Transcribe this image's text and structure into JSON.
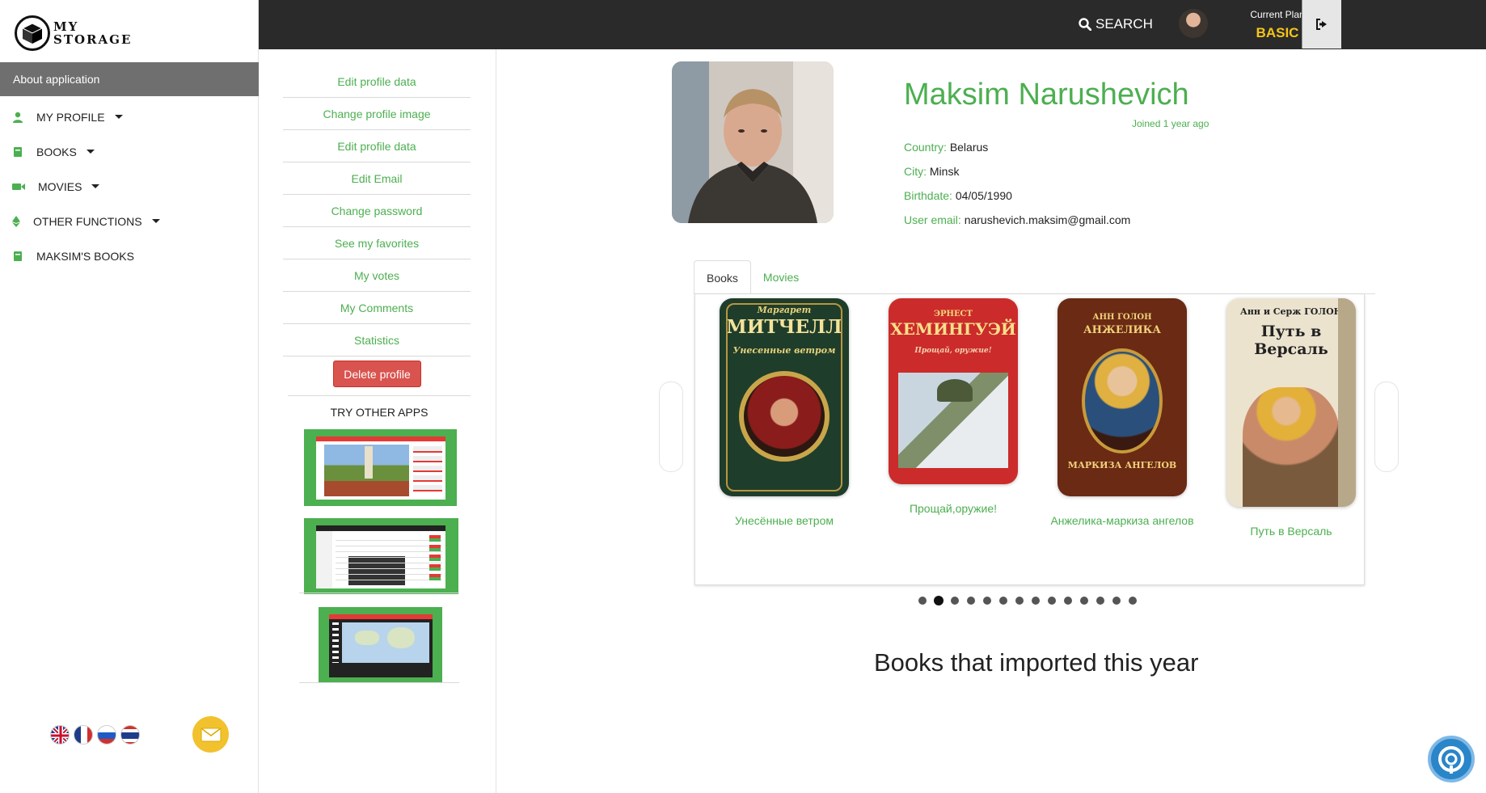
{
  "sidebar": {
    "logo_text_line1": "MY",
    "logo_text_line2": "STORAGE",
    "about": "About application",
    "items": [
      {
        "label": "MY PROFILE",
        "icon": "user-icon"
      },
      {
        "label": "BOOKS",
        "icon": "book-icon"
      },
      {
        "label": "MOVIES",
        "icon": "video-camera-icon"
      },
      {
        "label": "OTHER FUNCTIONS",
        "icon": "ethereum-icon"
      },
      {
        "label": "MAKSIM'S BOOKS",
        "icon": "book-icon"
      }
    ],
    "languages": [
      "English",
      "French",
      "Russian",
      "Thai"
    ]
  },
  "topbar": {
    "search_label": "SEARCH",
    "plan_label": "Current Plan",
    "plan_value": "BASIC"
  },
  "profile_menu": {
    "links": [
      "Edit profile data",
      "Change profile image",
      "Edit profile data",
      "Edit Email",
      "Change password",
      "See my favorites",
      "My votes",
      "My Comments",
      "Statistics"
    ],
    "delete_label": "Delete profile",
    "try_apps_label": "TRY OTHER APPS"
  },
  "profile": {
    "name": "Maksim Narushevich",
    "joined": "Joined 1 year ago",
    "country_label": "Country:",
    "country": "Belarus",
    "city_label": "City:",
    "city": "Minsk",
    "birthdate_label": "Birthdate:",
    "birthdate": "04/05/1990",
    "email_label": "User email:",
    "email": "narushevich.maksim@gmail.com"
  },
  "tabs": [
    {
      "label": "Books",
      "active": true
    },
    {
      "label": "Movies",
      "active": false
    }
  ],
  "books": [
    {
      "title": "Унесённые ветром",
      "author": "Маргарет",
      "cover_title": "МИТЧЕЛЛ",
      "cover_sub": "Унесенные ветром"
    },
    {
      "title": "Прощай,оружие!",
      "author": "ЭРНЕСТ",
      "cover_title": "ХЕМИНГУЭЙ",
      "cover_sub": "Прощай, оружие!"
    },
    {
      "title": "Анжелика-маркиза ангелов",
      "author": "АНН ГОЛОН",
      "cover_title": "АНЖЕЛИКА",
      "cover_sub": "МАРКИЗА АНГЕЛОВ"
    },
    {
      "title": "Путь в Версаль",
      "author": "Анн и Серж ГОЛОН",
      "cover_title": "Путь в Версаль",
      "cover_sub": ""
    }
  ],
  "carousel": {
    "dot_count": 14,
    "active_index": 1
  },
  "section_title": "Books that imported this year",
  "colors": {
    "accent": "#4caf50",
    "topbar": "#2a2a2a",
    "plan": "#f5c518",
    "danger": "#d9534f"
  }
}
